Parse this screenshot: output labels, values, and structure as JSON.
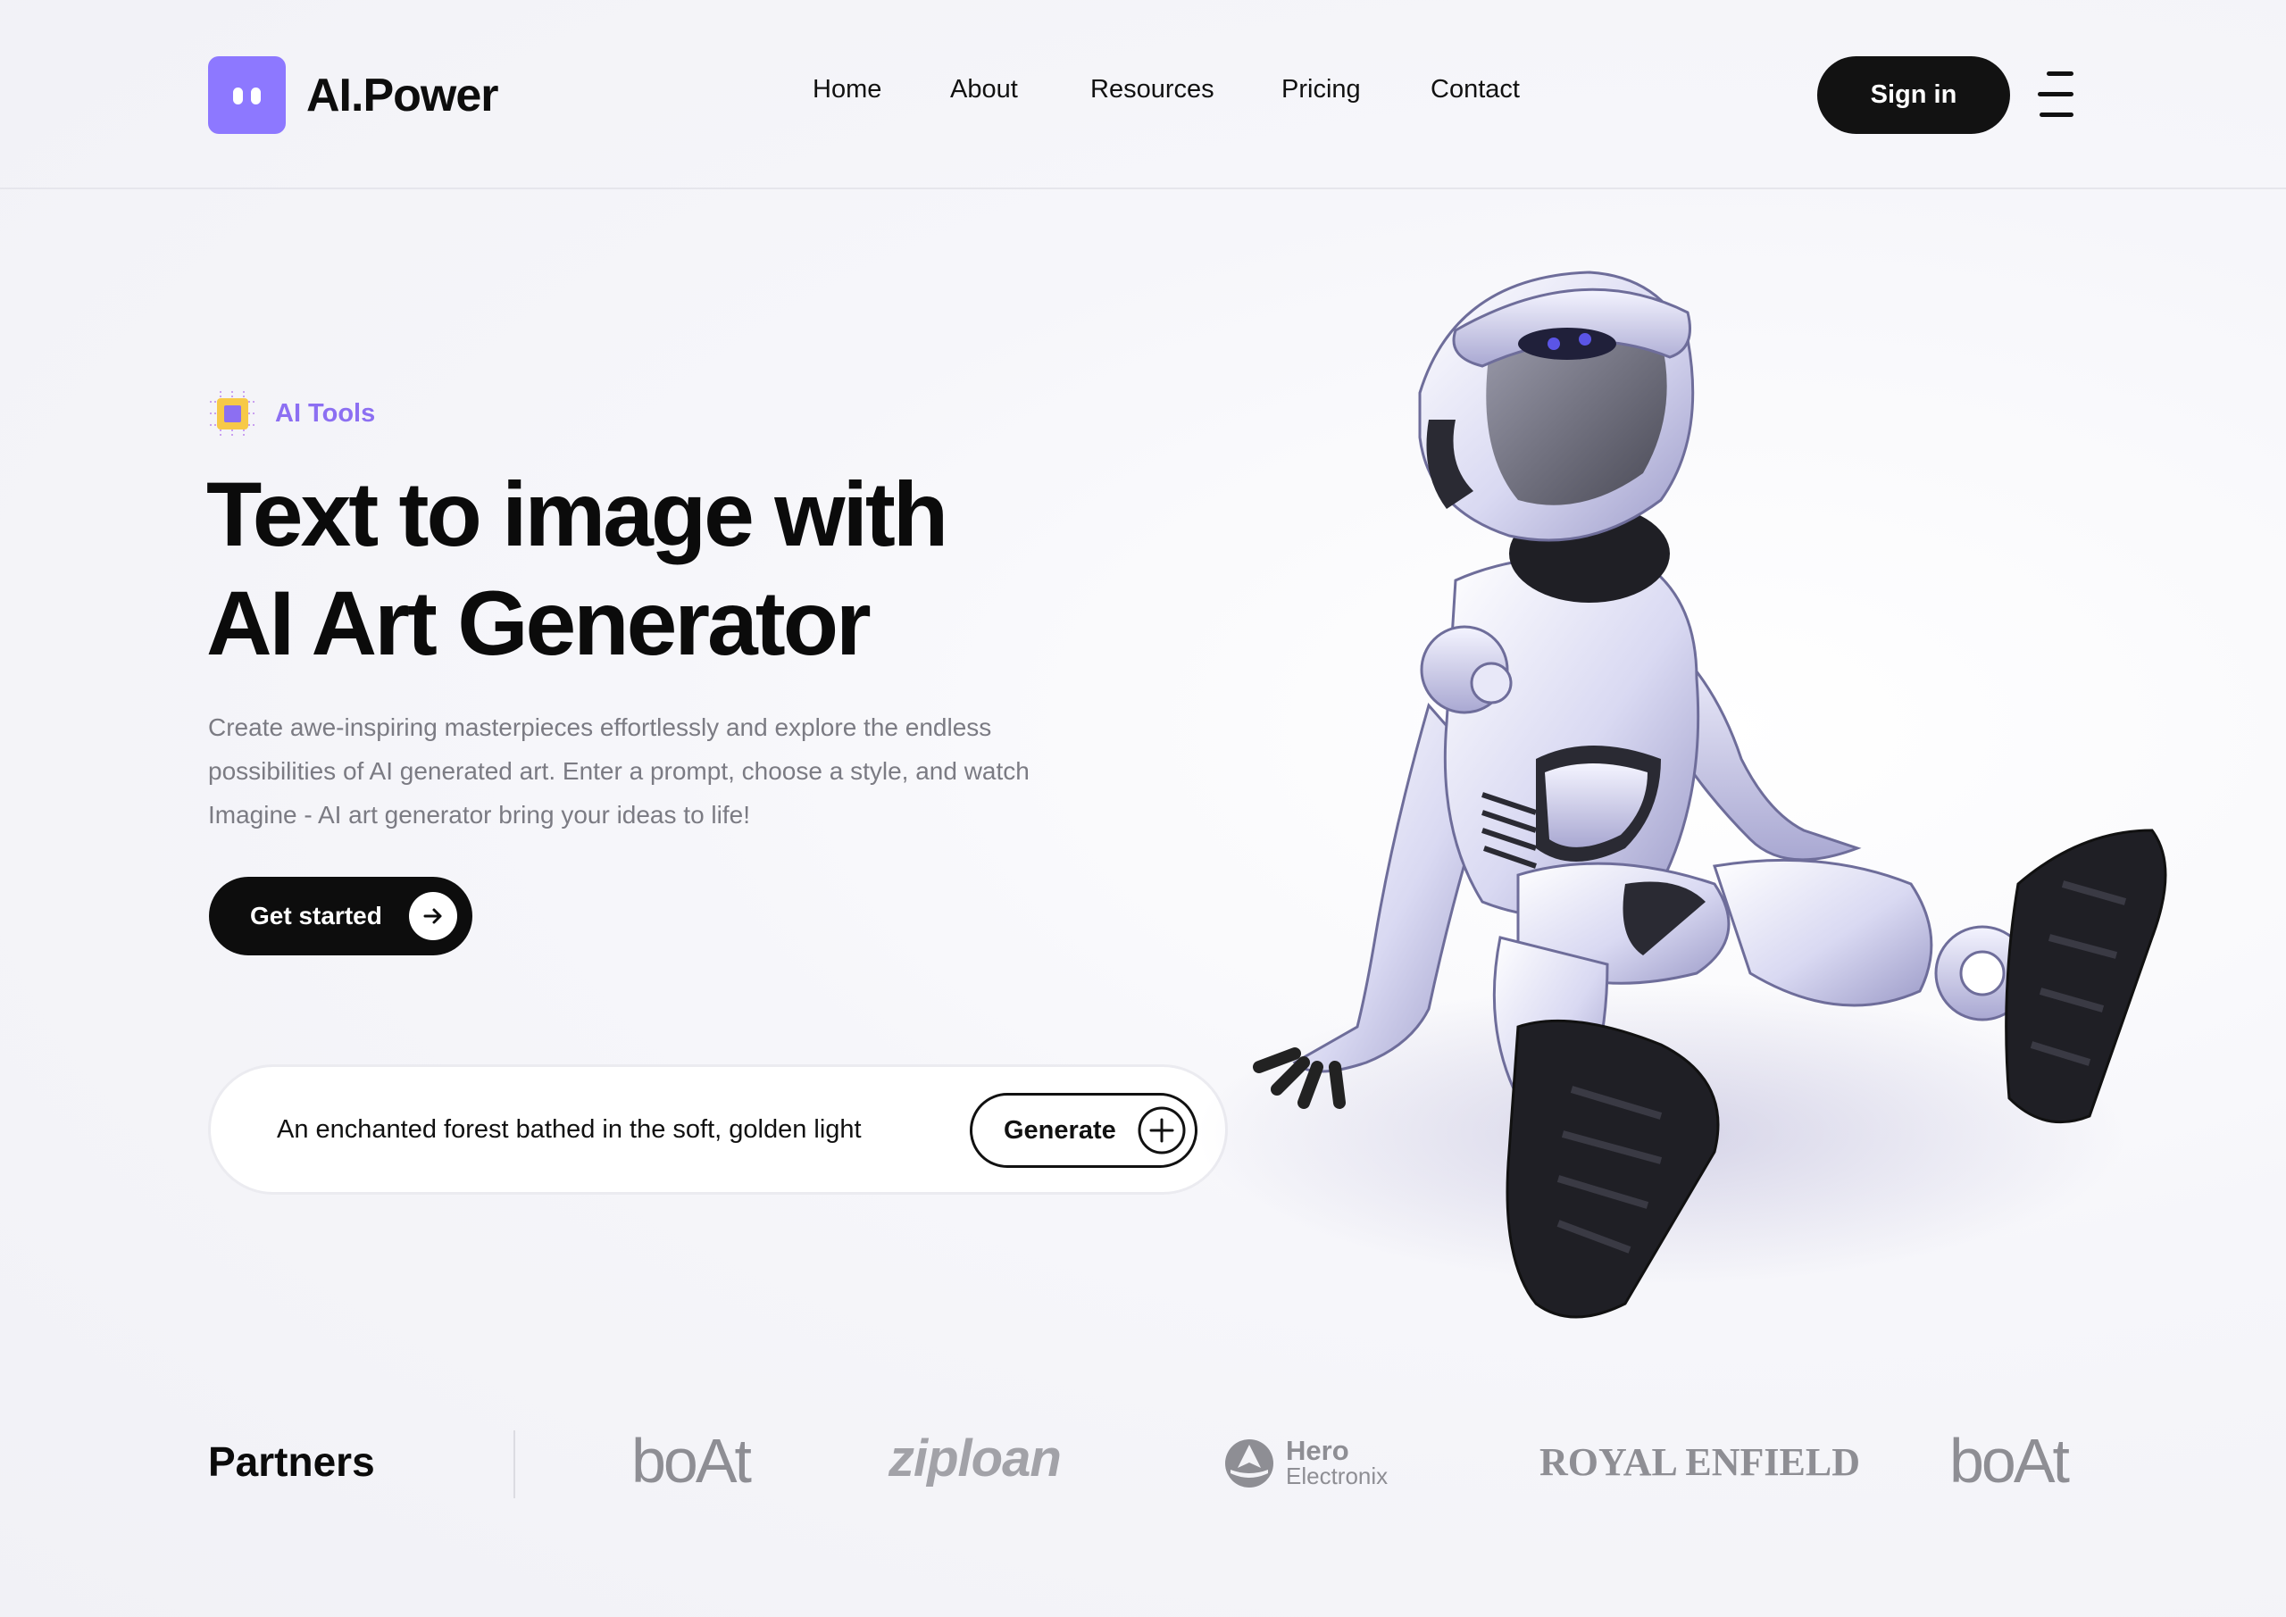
{
  "brand": {
    "name": "AI.Power",
    "accent": "#8d78ff"
  },
  "nav": {
    "items": [
      "Home",
      "About",
      "Resources",
      "Pricing",
      "Contact"
    ],
    "sign_in": "Sign in"
  },
  "hero": {
    "badge": "AI Tools",
    "headline_line1": "Text to image with",
    "headline_line2": "AI Art Generator",
    "description": "Create awe-inspiring masterpieces effortlessly and explore the endless possibilities of AI generated art. Enter a prompt, choose a style, and watch Imagine - AI art generator bring your ideas to life!",
    "cta_label": "Get started"
  },
  "prompt": {
    "value": "An enchanted forest bathed in the soft, golden light",
    "button_label": "Generate"
  },
  "partners": {
    "title": "Partners",
    "logos": [
      "boAt",
      "ziploan",
      "Hero",
      "Electronix",
      "ROYAL ENFIELD",
      "boAt"
    ]
  },
  "icons": [
    "logo-icon",
    "menu-icon",
    "chip-icon",
    "arrow-right-icon",
    "plus-circle-icon",
    "hero-logo-icon"
  ]
}
